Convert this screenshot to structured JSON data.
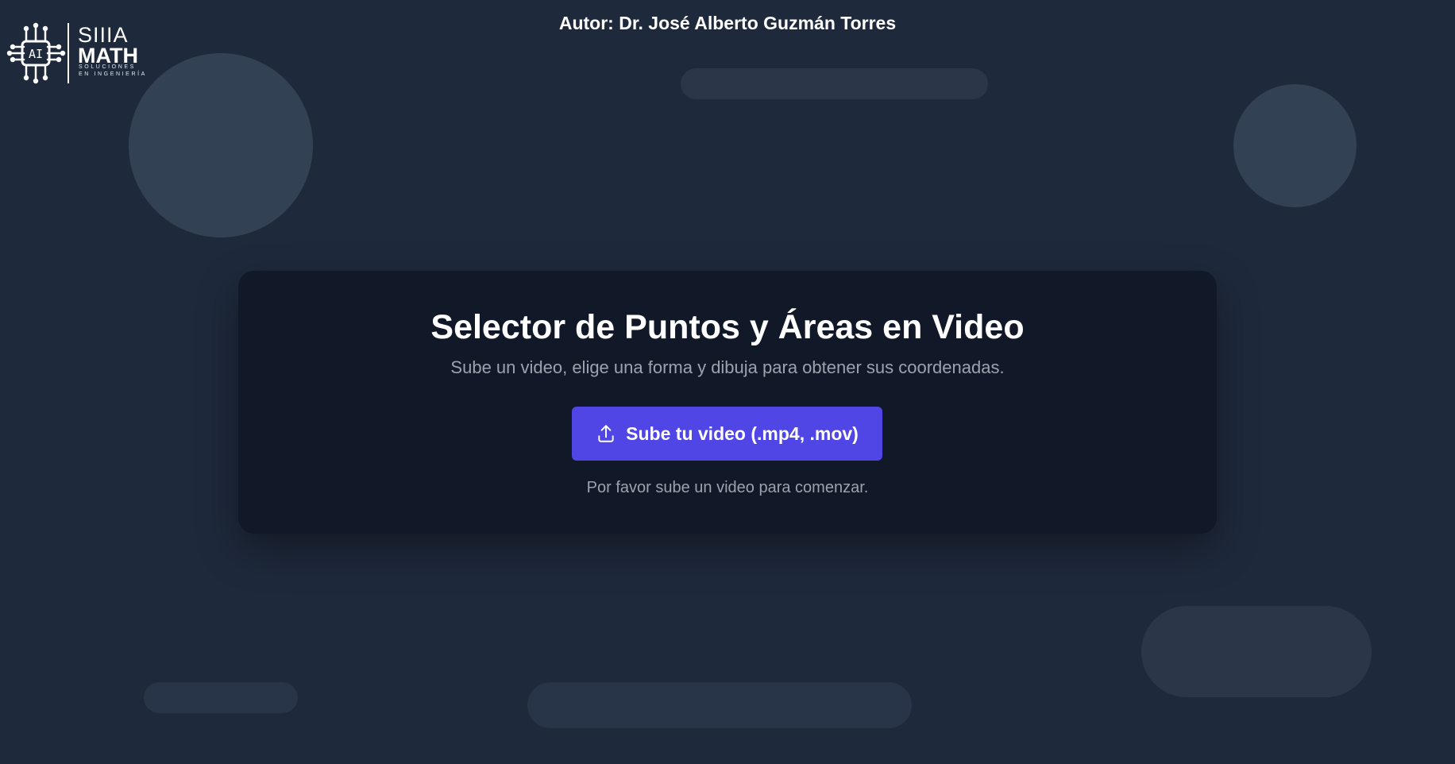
{
  "logo": {
    "chip_text": "AI",
    "brand_top": "SIIIA",
    "brand_bottom": "MATH",
    "tagline_line1": "SOLUCIONES",
    "tagline_line2": "EN INGENIERÍA"
  },
  "header": {
    "author": "Autor: Dr. José Alberto Guzmán Torres"
  },
  "main": {
    "title": "Selector de Puntos y Áreas en Video",
    "subtitle": "Sube un video, elige una forma y dibuja para obtener sus coordenadas.",
    "upload_button": {
      "label": "Sube tu video (.mp4, .mov)",
      "icon": "upload-icon"
    },
    "status": "Por favor sube un video para comenzar."
  },
  "colors": {
    "background": "#1e293b",
    "card": "#111827",
    "accent": "#4f46e5",
    "muted_text": "#9ca3af",
    "decor_shape": "#334155"
  }
}
